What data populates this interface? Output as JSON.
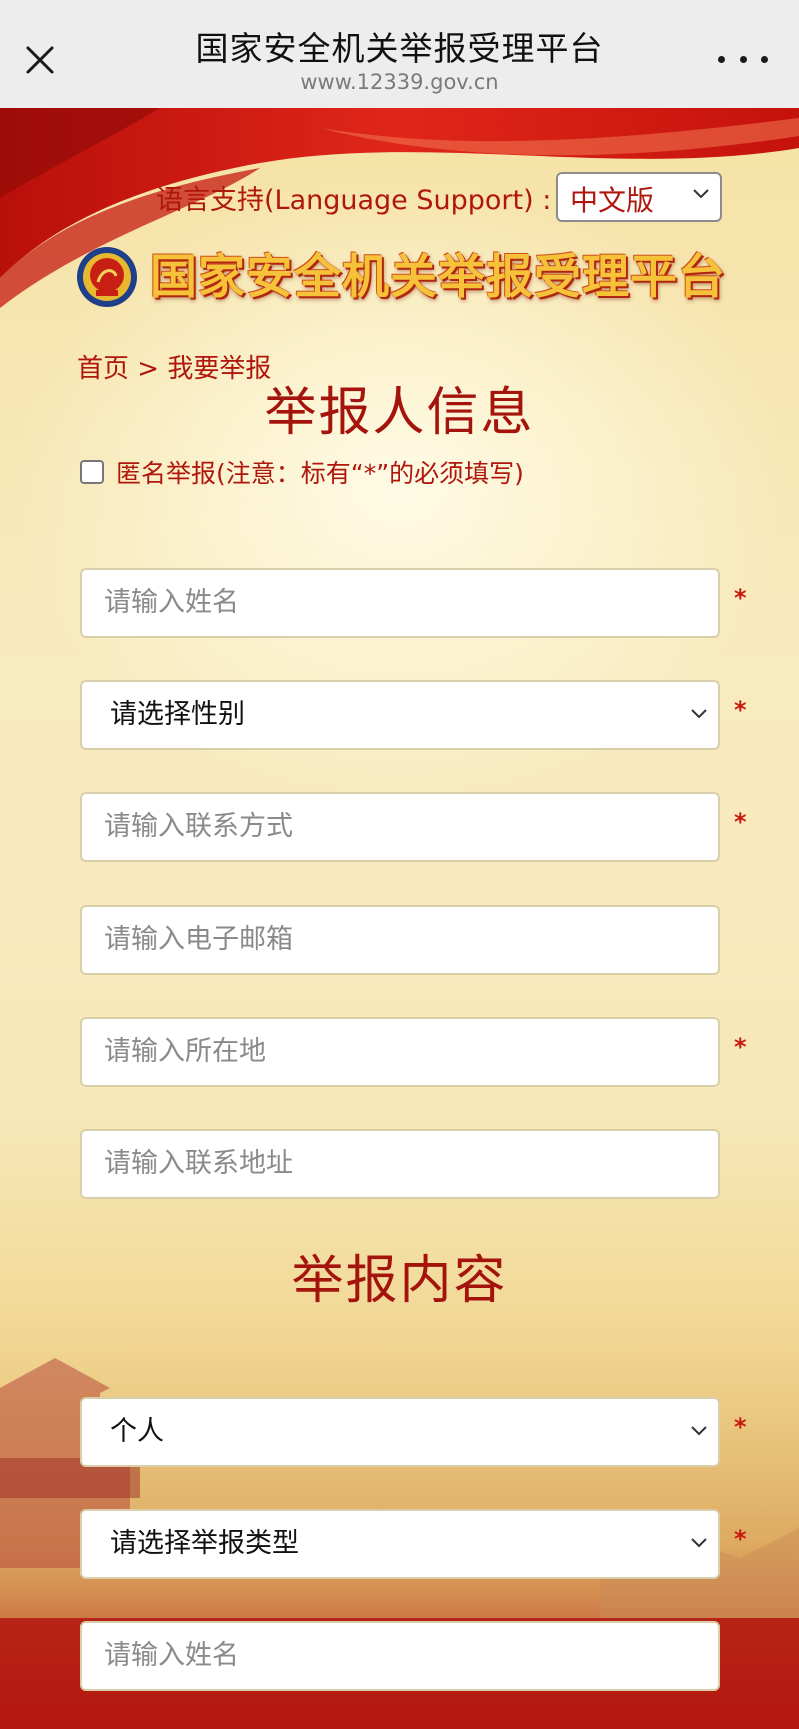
{
  "topbar": {
    "title": "国家安全机关举报受理平台",
    "url": "www.12339.gov.cn"
  },
  "language": {
    "label": "语言支持(Language Support) :",
    "selected": "中文版"
  },
  "banner": {
    "title": "国家安全机关举报受理平台"
  },
  "breadcrumb": "首页 > 我要举报",
  "reporter_section": {
    "title": "举报人信息",
    "anonymous_label": "匿名举报(注意：标有“*”的必须填写)",
    "name_placeholder": "请输入姓名",
    "gender_selected": "请选择性别",
    "contact_placeholder": "请输入联系方式",
    "email_placeholder": "请输入电子邮箱",
    "location_placeholder": "请输入所在地",
    "address_placeholder": "请输入联系地址",
    "required_mark": "*"
  },
  "content_section": {
    "title": "举报内容",
    "target_selected": "个人",
    "type_selected": "请选择举报类型",
    "name_placeholder": "请输入姓名"
  },
  "colors": {
    "accent_red": "#b0170c",
    "title_gold": "#f6c23a"
  }
}
